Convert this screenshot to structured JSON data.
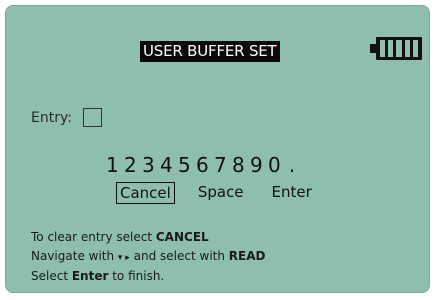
{
  "title": "USER BUFFER SET",
  "battery": {
    "icon": "battery-full-icon",
    "bars": 5
  },
  "entry": {
    "label": "Entry:",
    "value": ""
  },
  "keypad": [
    "1",
    "2",
    "3",
    "4",
    "5",
    "6",
    "7",
    "8",
    "9",
    "0",
    "."
  ],
  "actions": [
    "Cancel",
    "Space",
    "Enter"
  ],
  "selected_action": "Cancel",
  "help": {
    "line1_pre": "To clear entry select ",
    "line1_bold": "CANCEL",
    "line2_pre": "Navigate with ",
    "line2_arrows": "▾ ▸",
    "line2_mid": " and select with ",
    "line2_bold": "READ",
    "line3_pre": "Select ",
    "line3_bold": "Enter",
    "line3_post": " to finish."
  },
  "colors": {
    "screen": "#8ebfad",
    "title_bg": "#0a0a0a",
    "text": "#111111"
  }
}
